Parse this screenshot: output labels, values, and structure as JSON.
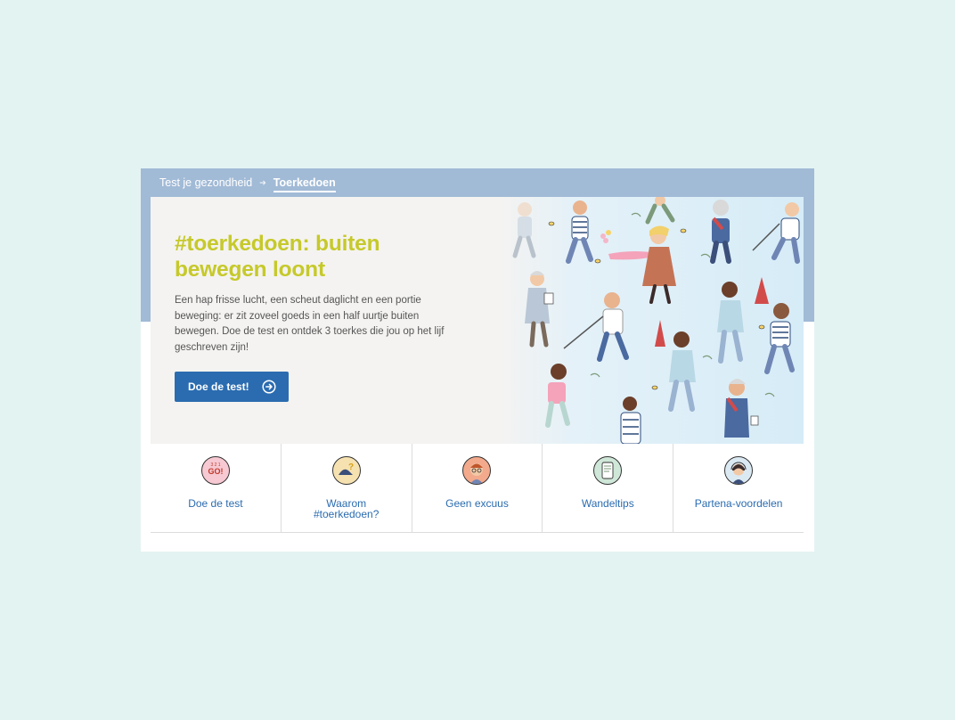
{
  "breadcrumb": {
    "parent": "Test je gezondheid",
    "current": "Toerkedoen"
  },
  "hero": {
    "title": "#toerkedoen: buiten bewegen loont",
    "description": "Een hap frisse lucht, een scheut daglicht en een portie beweging: er zit zoveel goeds in een half uurtje buiten bewegen. Doe de test en ontdek 3 toerkes die jou op het lijf geschreven zijn!",
    "cta_label": "Doe de test!",
    "cta_icon": "arrow-circle-right-icon"
  },
  "tiles": [
    {
      "label": "Doe de test",
      "icon": "go-sign-icon"
    },
    {
      "label": "Waarom\n#toerkedoen?",
      "icon": "question-shoe-icon"
    },
    {
      "label": "Geen excuus",
      "icon": "person-glasses-icon"
    },
    {
      "label": "Wandeltips",
      "icon": "phone-tips-icon"
    },
    {
      "label": "Partena-voordelen",
      "icon": "headset-person-icon"
    }
  ],
  "colors": {
    "page_background": "#e3f3f2",
    "band": "#a1bad6",
    "title": "#c6c92a",
    "accent": "#2b6cb0",
    "hero_background": "#f4f3f1"
  }
}
